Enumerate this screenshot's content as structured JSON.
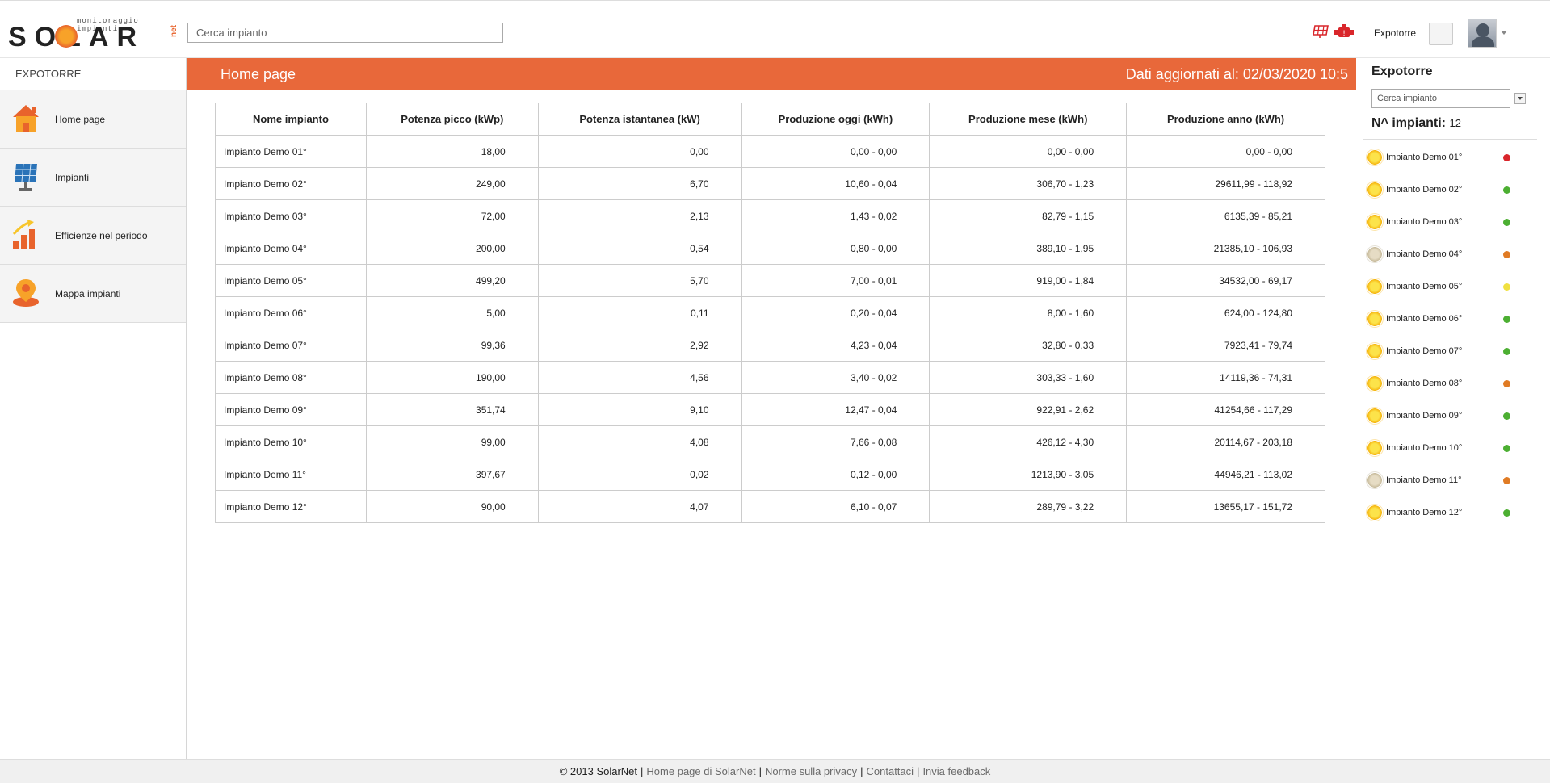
{
  "header": {
    "logo_tagline": "monitoraggio impianti",
    "logo_text": "SOLAR",
    "logo_net": "net",
    "search_placeholder": "Cerca impianto",
    "username": "Expotorre"
  },
  "sidebar": {
    "title": "EXPOTORRE",
    "items": [
      {
        "label": "Home page",
        "icon": "home-icon"
      },
      {
        "label": "Impianti",
        "icon": "solar-panel-icon"
      },
      {
        "label": "Efficienze nel periodo",
        "icon": "bar-chart-icon"
      },
      {
        "label": "Mappa impianti",
        "icon": "map-pin-icon"
      }
    ]
  },
  "main": {
    "title": "Home page",
    "updated": "Dati aggiornati al: 02/03/2020 10:5",
    "accent_color": "#e8683a",
    "table": {
      "headers": [
        "Nome impianto",
        "Potenza picco (kWp)",
        "Potenza istantanea (kW)",
        "Produzione oggi (kWh)",
        "Produzione mese (kWh)",
        "Produzione anno (kWh)"
      ],
      "rows": [
        [
          "Impianto Demo 01°",
          "18,00",
          "0,00",
          "0,00 - 0,00",
          "0,00 - 0,00",
          "0,00 - 0,00"
        ],
        [
          "Impianto Demo 02°",
          "249,00",
          "6,70",
          "10,60 - 0,04",
          "306,70 - 1,23",
          "29611,99 - 118,92"
        ],
        [
          "Impianto Demo 03°",
          "72,00",
          "2,13",
          "1,43 - 0,02",
          "82,79 - 1,15",
          "6135,39 - 85,21"
        ],
        [
          "Impianto Demo 04°",
          "200,00",
          "0,54",
          "0,80 - 0,00",
          "389,10 - 1,95",
          "21385,10 - 106,93"
        ],
        [
          "Impianto Demo 05°",
          "499,20",
          "5,70",
          "7,00 - 0,01",
          "919,00 - 1,84",
          "34532,00 - 69,17"
        ],
        [
          "Impianto Demo 06°",
          "5,00",
          "0,11",
          "0,20 - 0,04",
          "8,00 - 1,60",
          "624,00 - 124,80"
        ],
        [
          "Impianto Demo 07°",
          "99,36",
          "2,92",
          "4,23 - 0,04",
          "32,80 - 0,33",
          "7923,41 - 79,74"
        ],
        [
          "Impianto Demo 08°",
          "190,00",
          "4,56",
          "3,40 - 0,02",
          "303,33 - 1,60",
          "14119,36 - 74,31"
        ],
        [
          "Impianto Demo 09°",
          "351,74",
          "9,10",
          "12,47 - 0,04",
          "922,91 - 2,62",
          "41254,66 - 117,29"
        ],
        [
          "Impianto Demo 10°",
          "99,00",
          "4,08",
          "7,66 - 0,08",
          "426,12 - 4,30",
          "20114,67 - 203,18"
        ],
        [
          "Impianto Demo 11°",
          "397,67",
          "0,02",
          "0,12 - 0,00",
          "1213,90 - 3,05",
          "44946,21 - 113,02"
        ],
        [
          "Impianto Demo 12°",
          "90,00",
          "4,07",
          "6,10 - 0,07",
          "289,79 - 3,22",
          "13655,17 - 151,72"
        ]
      ]
    }
  },
  "right_panel": {
    "title": "Expotorre",
    "search_placeholder": "Cerca impianto",
    "count_label": "N^ impianti:",
    "count": "12",
    "plants": [
      {
        "name": "Impianto Demo 01°",
        "sun": "on",
        "status_color": "#d9262b"
      },
      {
        "name": "Impianto Demo 02°",
        "sun": "on",
        "status_color": "#4caf32"
      },
      {
        "name": "Impianto Demo 03°",
        "sun": "on",
        "status_color": "#4caf32"
      },
      {
        "name": "Impianto Demo 04°",
        "sun": "off",
        "status_color": "#e07b24"
      },
      {
        "name": "Impianto Demo 05°",
        "sun": "on",
        "status_color": "#f0e040"
      },
      {
        "name": "Impianto Demo 06°",
        "sun": "on",
        "status_color": "#4caf32"
      },
      {
        "name": "Impianto Demo 07°",
        "sun": "on",
        "status_color": "#4caf32"
      },
      {
        "name": "Impianto Demo 08°",
        "sun": "on",
        "status_color": "#e07b24"
      },
      {
        "name": "Impianto Demo 09°",
        "sun": "on",
        "status_color": "#4caf32"
      },
      {
        "name": "Impianto Demo 10°",
        "sun": "on",
        "status_color": "#4caf32"
      },
      {
        "name": "Impianto Demo 11°",
        "sun": "off",
        "status_color": "#e07b24"
      },
      {
        "name": "Impianto Demo 12°",
        "sun": "on",
        "status_color": "#4caf32"
      }
    ]
  },
  "footer": {
    "copyright": "© 2013 SolarNet",
    "links": [
      "Home page di SolarNet",
      "Norme sulla privacy",
      "Contattaci",
      "Invia feedback"
    ]
  }
}
